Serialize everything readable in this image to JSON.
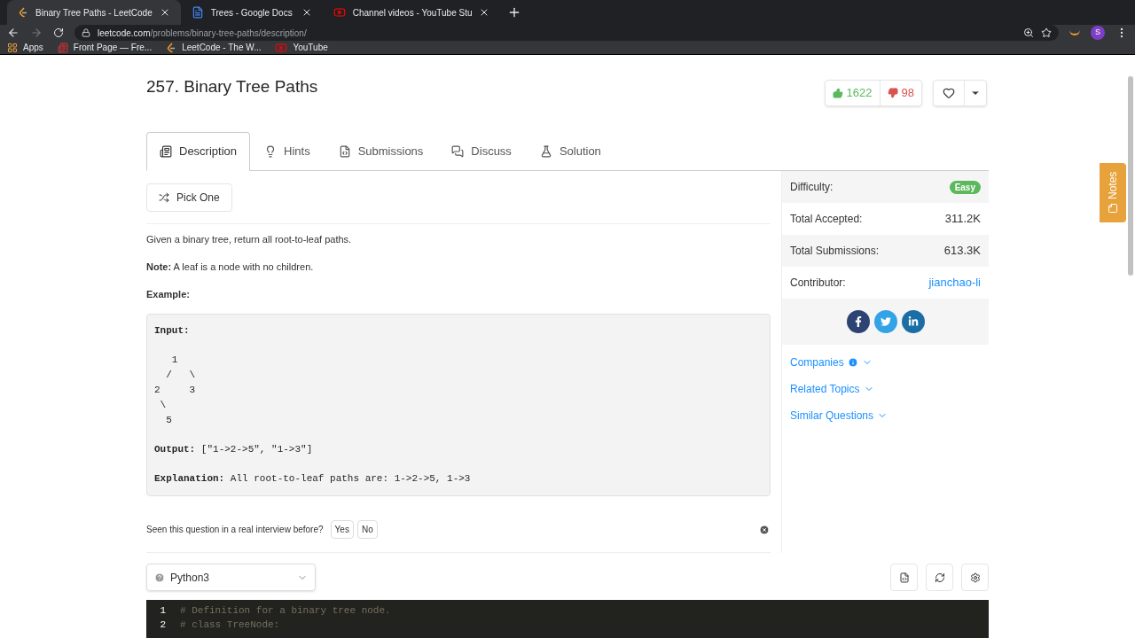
{
  "browser": {
    "tabs": [
      {
        "title": "Binary Tree Paths - LeetCode",
        "kind": "leetcode",
        "selected": true
      },
      {
        "title": "Trees - Google Docs",
        "kind": "docs",
        "selected": false
      },
      {
        "title": "Channel videos - YouTube Stu",
        "kind": "youtube",
        "selected": false
      }
    ],
    "url_host": "leetcode.com",
    "url_path": "/problems/binary-tree-paths/description/",
    "profile_initial": "S",
    "bookmarks": [
      {
        "label": "Apps",
        "kind": "apps"
      },
      {
        "label": "Front Page — Fre...",
        "kind": "page"
      },
      {
        "label": "LeetCode - The W...",
        "kind": "leetcode"
      },
      {
        "label": "YouTube",
        "kind": "youtube"
      }
    ]
  },
  "problem": {
    "title": "257. Binary Tree Paths",
    "likes": "1622",
    "dislikes": "98"
  },
  "tabs": [
    {
      "label": "Description",
      "kind": "description",
      "selected": true
    },
    {
      "label": "Hints",
      "kind": "hints",
      "selected": false
    },
    {
      "label": "Submissions",
      "kind": "submissions",
      "selected": false
    },
    {
      "label": "Discuss",
      "kind": "discuss",
      "selected": false
    },
    {
      "label": "Solution",
      "kind": "solution",
      "selected": false
    }
  ],
  "pick_one": "Pick One",
  "description": [
    "Given a binary tree, return all root-to-leaf paths.",
    "**Note:** A leaf is a node with no children."
  ],
  "example_heading": "Example:",
  "example": {
    "input_label": "Input:",
    "tree": [
      "   1",
      "  /   \\",
      "2     3",
      " \\",
      "  5"
    ],
    "output_label": "Output:",
    "output": "[\"1->2->5\", \"1->3\"]",
    "explanation_label": "Explanation:",
    "explanation": "All root-to-leaf paths are: 1->2->5, 1->3"
  },
  "interview": {
    "question": "Seen this question in a real interview before?",
    "yes": "Yes",
    "no": "No"
  },
  "stats": [
    {
      "label": "Difficulty:",
      "value": "Easy",
      "kind": "badge"
    },
    {
      "label": "Total Accepted:",
      "value": "311.2K",
      "kind": "text"
    },
    {
      "label": "Total Submissions:",
      "value": "613.3K",
      "kind": "text"
    },
    {
      "label": "Contributor:",
      "value": "jianchao-li",
      "kind": "link"
    }
  ],
  "sections": [
    {
      "label": "Companies",
      "info": true
    },
    {
      "label": "Related Topics",
      "info": false
    },
    {
      "label": "Similar Questions",
      "info": false
    }
  ],
  "language": "Python3",
  "code": [
    {
      "number": "1",
      "text": "# Definition for a binary tree node."
    },
    {
      "number": "2",
      "text": "# class TreeNode:"
    }
  ],
  "notes": "Notes"
}
